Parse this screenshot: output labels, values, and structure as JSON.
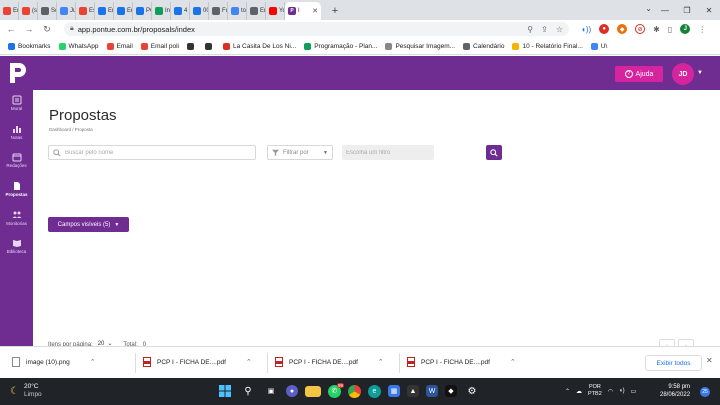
{
  "browser": {
    "tabs": [
      {
        "label": "Envi",
        "icon": "gmail-icon",
        "color": "#ea4335"
      },
      {
        "label": "(sen",
        "icon": "gmail-icon",
        "color": "#ea4335"
      },
      {
        "label": "Sorr",
        "icon": "mail-icon",
        "color": "#5f6368"
      },
      {
        "label": "Juan",
        "icon": "docs-icon",
        "color": "#4285f4"
      },
      {
        "label": "Estu",
        "icon": "gmail-icon",
        "color": "#ea4335"
      },
      {
        "label": "Envi",
        "icon": "box-icon",
        "color": "#1a73e8"
      },
      {
        "label": "Envi",
        "icon": "box-icon",
        "color": "#1a73e8"
      },
      {
        "label": "PCP",
        "icon": "box-icon",
        "color": "#1a73e8"
      },
      {
        "label": "Inte",
        "icon": "sheets-icon",
        "color": "#0f9d58"
      },
      {
        "label": "4 -",
        "icon": "box-icon",
        "color": "#1a73e8"
      },
      {
        "label": "000",
        "icon": "box-icon",
        "color": "#1a73e8"
      },
      {
        "label": "Full",
        "icon": "globe-icon",
        "color": "#5f6368"
      },
      {
        "label": "top",
        "icon": "google-icon",
        "color": "#4285f4"
      },
      {
        "label": "Entr",
        "icon": "globe-icon",
        "color": "#5f6368"
      },
      {
        "label": "You",
        "icon": "youtube-icon",
        "color": "#ff0000"
      }
    ],
    "active_tab": {
      "label": "I",
      "icon": "pontue-icon",
      "color": "#6f2c91"
    },
    "url": "app.pontue.com.br/proposals/index",
    "bookmarks": [
      {
        "label": "Bookmarks",
        "icon": "star-icon",
        "color": "#1a73e8"
      },
      {
        "label": "WhatsApp",
        "icon": "whatsapp-icon",
        "color": "#25d366"
      },
      {
        "label": "Email",
        "icon": "gmail-icon",
        "color": "#ea4335"
      },
      {
        "label": "Email poli",
        "icon": "gmail-icon",
        "color": "#ea4335"
      },
      {
        "label": "",
        "icon": "key-icon",
        "color": "#333333"
      },
      {
        "label": "",
        "icon": "globe-icon",
        "color": "#333333"
      },
      {
        "label": "La Casita De Los Ni...",
        "icon": "db-icon",
        "color": "#d93025"
      },
      {
        "label": "Programação - Plan...",
        "icon": "sheets-icon",
        "color": "#0f9d58"
      },
      {
        "label": "Pesquisar Imagem...",
        "icon": "sgf-icon",
        "color": "#888888"
      },
      {
        "label": "Calendário",
        "icon": "globe-icon",
        "color": "#5f6368"
      },
      {
        "label": "10 - Relatório Final...",
        "icon": "drive-icon",
        "color": "#f4b400"
      },
      {
        "label": "U\\",
        "icon": "docs-icon",
        "color": "#4285f4"
      }
    ]
  },
  "app": {
    "brand_color": "#6f2c91",
    "accent_color": "#d6249f",
    "help_label": "Ajuda",
    "avatar_initials": "JD",
    "sidebar": [
      {
        "label": "Mural",
        "icon": "mural-icon"
      },
      {
        "label": "Notas",
        "icon": "bar-chart-icon"
      },
      {
        "label": "Redações",
        "icon": "calendar-icon"
      },
      {
        "label": "Propostas",
        "icon": "document-icon",
        "active": true
      },
      {
        "label": "Monitorias",
        "icon": "people-icon"
      },
      {
        "label": "Biblioteca",
        "icon": "library-icon"
      }
    ],
    "page_title": "Propostas",
    "breadcrumb": "Dashboard  /  Proposta",
    "search_placeholder": "Buscar pelo nome",
    "filter_by_label": "Filtrar por",
    "filter_placeholder": "Escolha um filtro",
    "visible_fields_label": "Campos visíveis (5)",
    "items_per_page_label": "Itens por página:",
    "items_per_page_value": "20",
    "total_label": "Total:",
    "total_value": "0"
  },
  "downloads": {
    "items": [
      {
        "name": "image (10).png",
        "type": "png"
      },
      {
        "name": "PCP I - FICHA DE....pdf",
        "type": "pdf"
      },
      {
        "name": "PCP I - FICHA DE....pdf",
        "type": "pdf"
      },
      {
        "name": "PCP I - FICHA DE....pdf",
        "type": "pdf"
      }
    ],
    "show_all_label": "Exibir todos"
  },
  "taskbar": {
    "temperature": "20°C",
    "weather_desc": "Limpo",
    "lang_1": "POR",
    "lang_2": "PTB2",
    "time": "9:58 pm",
    "date": "28/06/2022",
    "whatsapp_badge": "99",
    "notif_count": "25"
  }
}
